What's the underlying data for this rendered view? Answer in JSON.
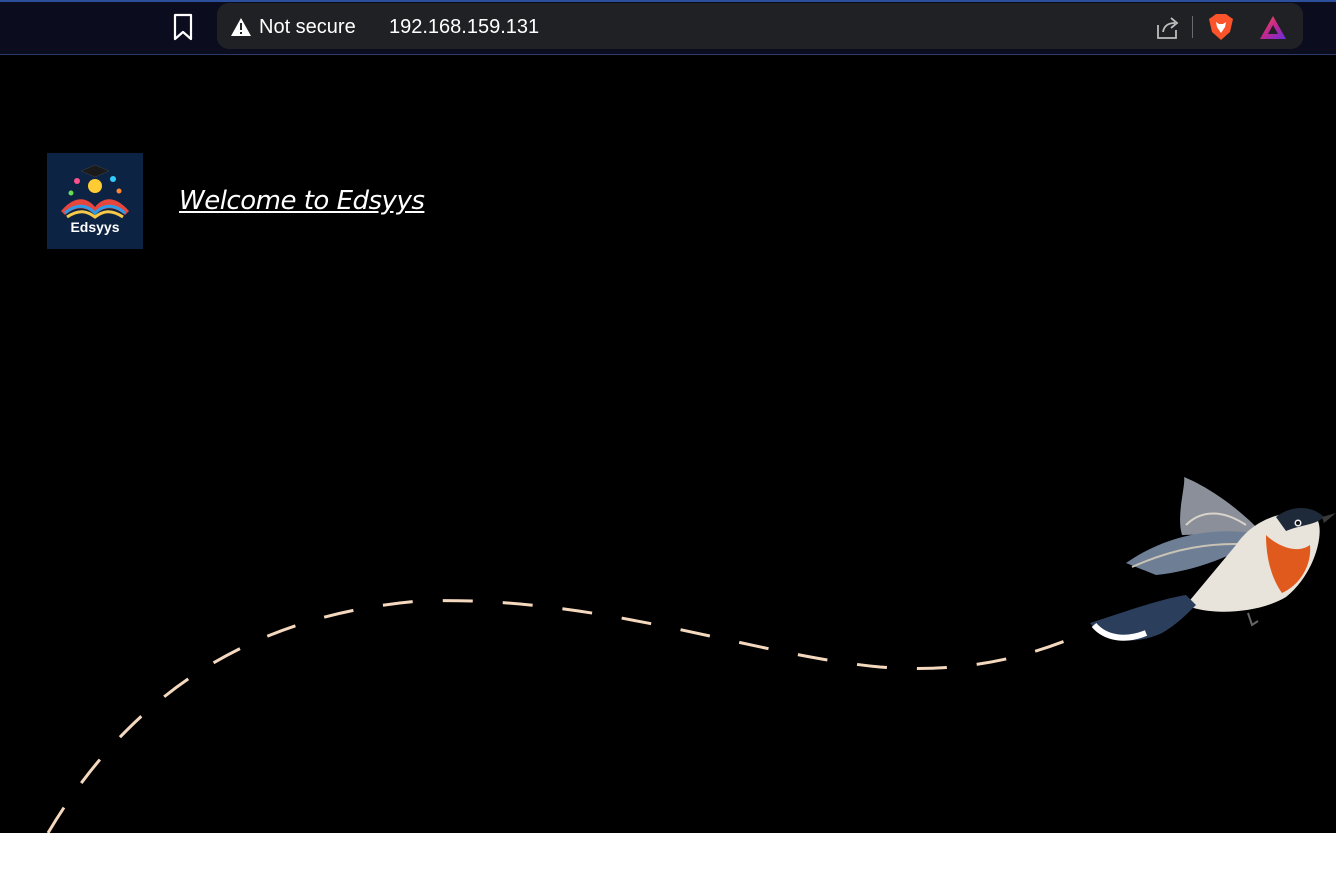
{
  "browser": {
    "security_label": "Not secure",
    "url": "192.168.159.131",
    "icons": [
      "bookmark-icon",
      "warning-icon",
      "share-icon",
      "brave-shield-icon",
      "brave-rewards-icon"
    ]
  },
  "page": {
    "logo_text": "Edsyys",
    "welcome_link": "Welcome to Edsyys",
    "background_color": "#000000",
    "path_color": "#f5d9bf"
  }
}
